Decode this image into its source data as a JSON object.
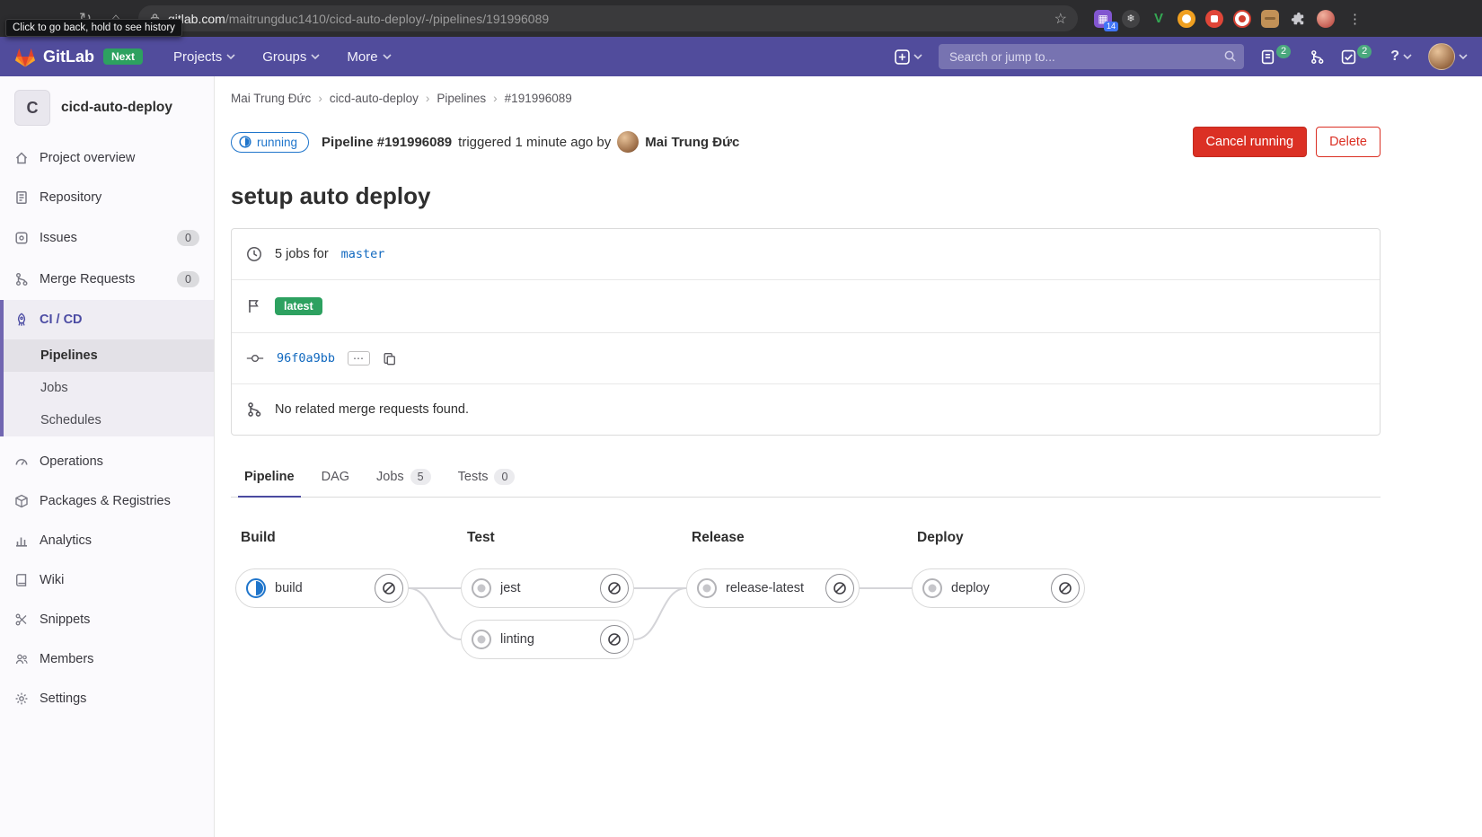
{
  "browser": {
    "tooltip": "Click to go back, hold to see history",
    "url_domain": "gitlab.com",
    "url_path": "/maitrungduc1410/cicd-auto-deploy/-/pipelines/191996089",
    "extension_badge": "14"
  },
  "navbar": {
    "logo_text": "GitLab",
    "next_badge": "Next",
    "menus": [
      {
        "label": "Projects"
      },
      {
        "label": "Groups"
      },
      {
        "label": "More"
      }
    ],
    "search_placeholder": "Search or jump to...",
    "issues_badge": "2",
    "todos_badge": "2",
    "help_label": "?"
  },
  "sidebar": {
    "project_initial": "C",
    "project_name": "cicd-auto-deploy",
    "top_items": [
      {
        "label": "Project overview"
      },
      {
        "label": "Repository"
      },
      {
        "label": "Issues",
        "badge": "0"
      },
      {
        "label": "Merge Requests",
        "badge": "0"
      }
    ],
    "cicd": {
      "label": "CI / CD",
      "subitems": [
        {
          "label": "Pipelines",
          "active": true
        },
        {
          "label": "Jobs"
        },
        {
          "label": "Schedules"
        }
      ]
    },
    "bottom_items": [
      {
        "label": "Operations"
      },
      {
        "label": "Packages & Registries"
      },
      {
        "label": "Analytics"
      },
      {
        "label": "Wiki"
      },
      {
        "label": "Snippets"
      },
      {
        "label": "Members"
      },
      {
        "label": "Settings"
      }
    ]
  },
  "breadcrumb": {
    "items": [
      "Mai Trung Đức",
      "cicd-auto-deploy",
      "Pipelines",
      "#191996089"
    ]
  },
  "status_row": {
    "badge": "running",
    "pipeline_label": "Pipeline #191996089",
    "triggered_text": "triggered 1 minute ago by",
    "author": "Mai Trung Đức",
    "cancel_button": "Cancel running",
    "delete_button": "Delete"
  },
  "pipeline": {
    "title": "setup auto deploy",
    "jobs_summary_prefix": "5 jobs for",
    "ref": "master",
    "tag": "latest",
    "commit_sha": "96f0a9bb",
    "commit_more": "⋯",
    "no_mr_message": "No related merge requests found."
  },
  "tabs": [
    {
      "label": "Pipeline",
      "active": true
    },
    {
      "label": "DAG"
    },
    {
      "label": "Jobs",
      "badge": "5"
    },
    {
      "label": "Tests",
      "badge": "0"
    }
  ],
  "graph": {
    "stages": [
      {
        "name": "Build",
        "jobs": [
          {
            "name": "build",
            "status": "running"
          }
        ]
      },
      {
        "name": "Test",
        "jobs": [
          {
            "name": "jest",
            "status": "created"
          },
          {
            "name": "linting",
            "status": "created"
          }
        ]
      },
      {
        "name": "Release",
        "jobs": [
          {
            "name": "release-latest",
            "status": "created"
          }
        ]
      },
      {
        "name": "Deploy",
        "jobs": [
          {
            "name": "deploy",
            "status": "created"
          }
        ]
      }
    ]
  },
  "colors": {
    "navbar_bg": "#514c9c",
    "accent_purple": "#6666c4",
    "danger_red": "#db3024",
    "link_blue": "#1068bf",
    "running_blue": "#1f75cb",
    "success_green": "#2da160"
  }
}
